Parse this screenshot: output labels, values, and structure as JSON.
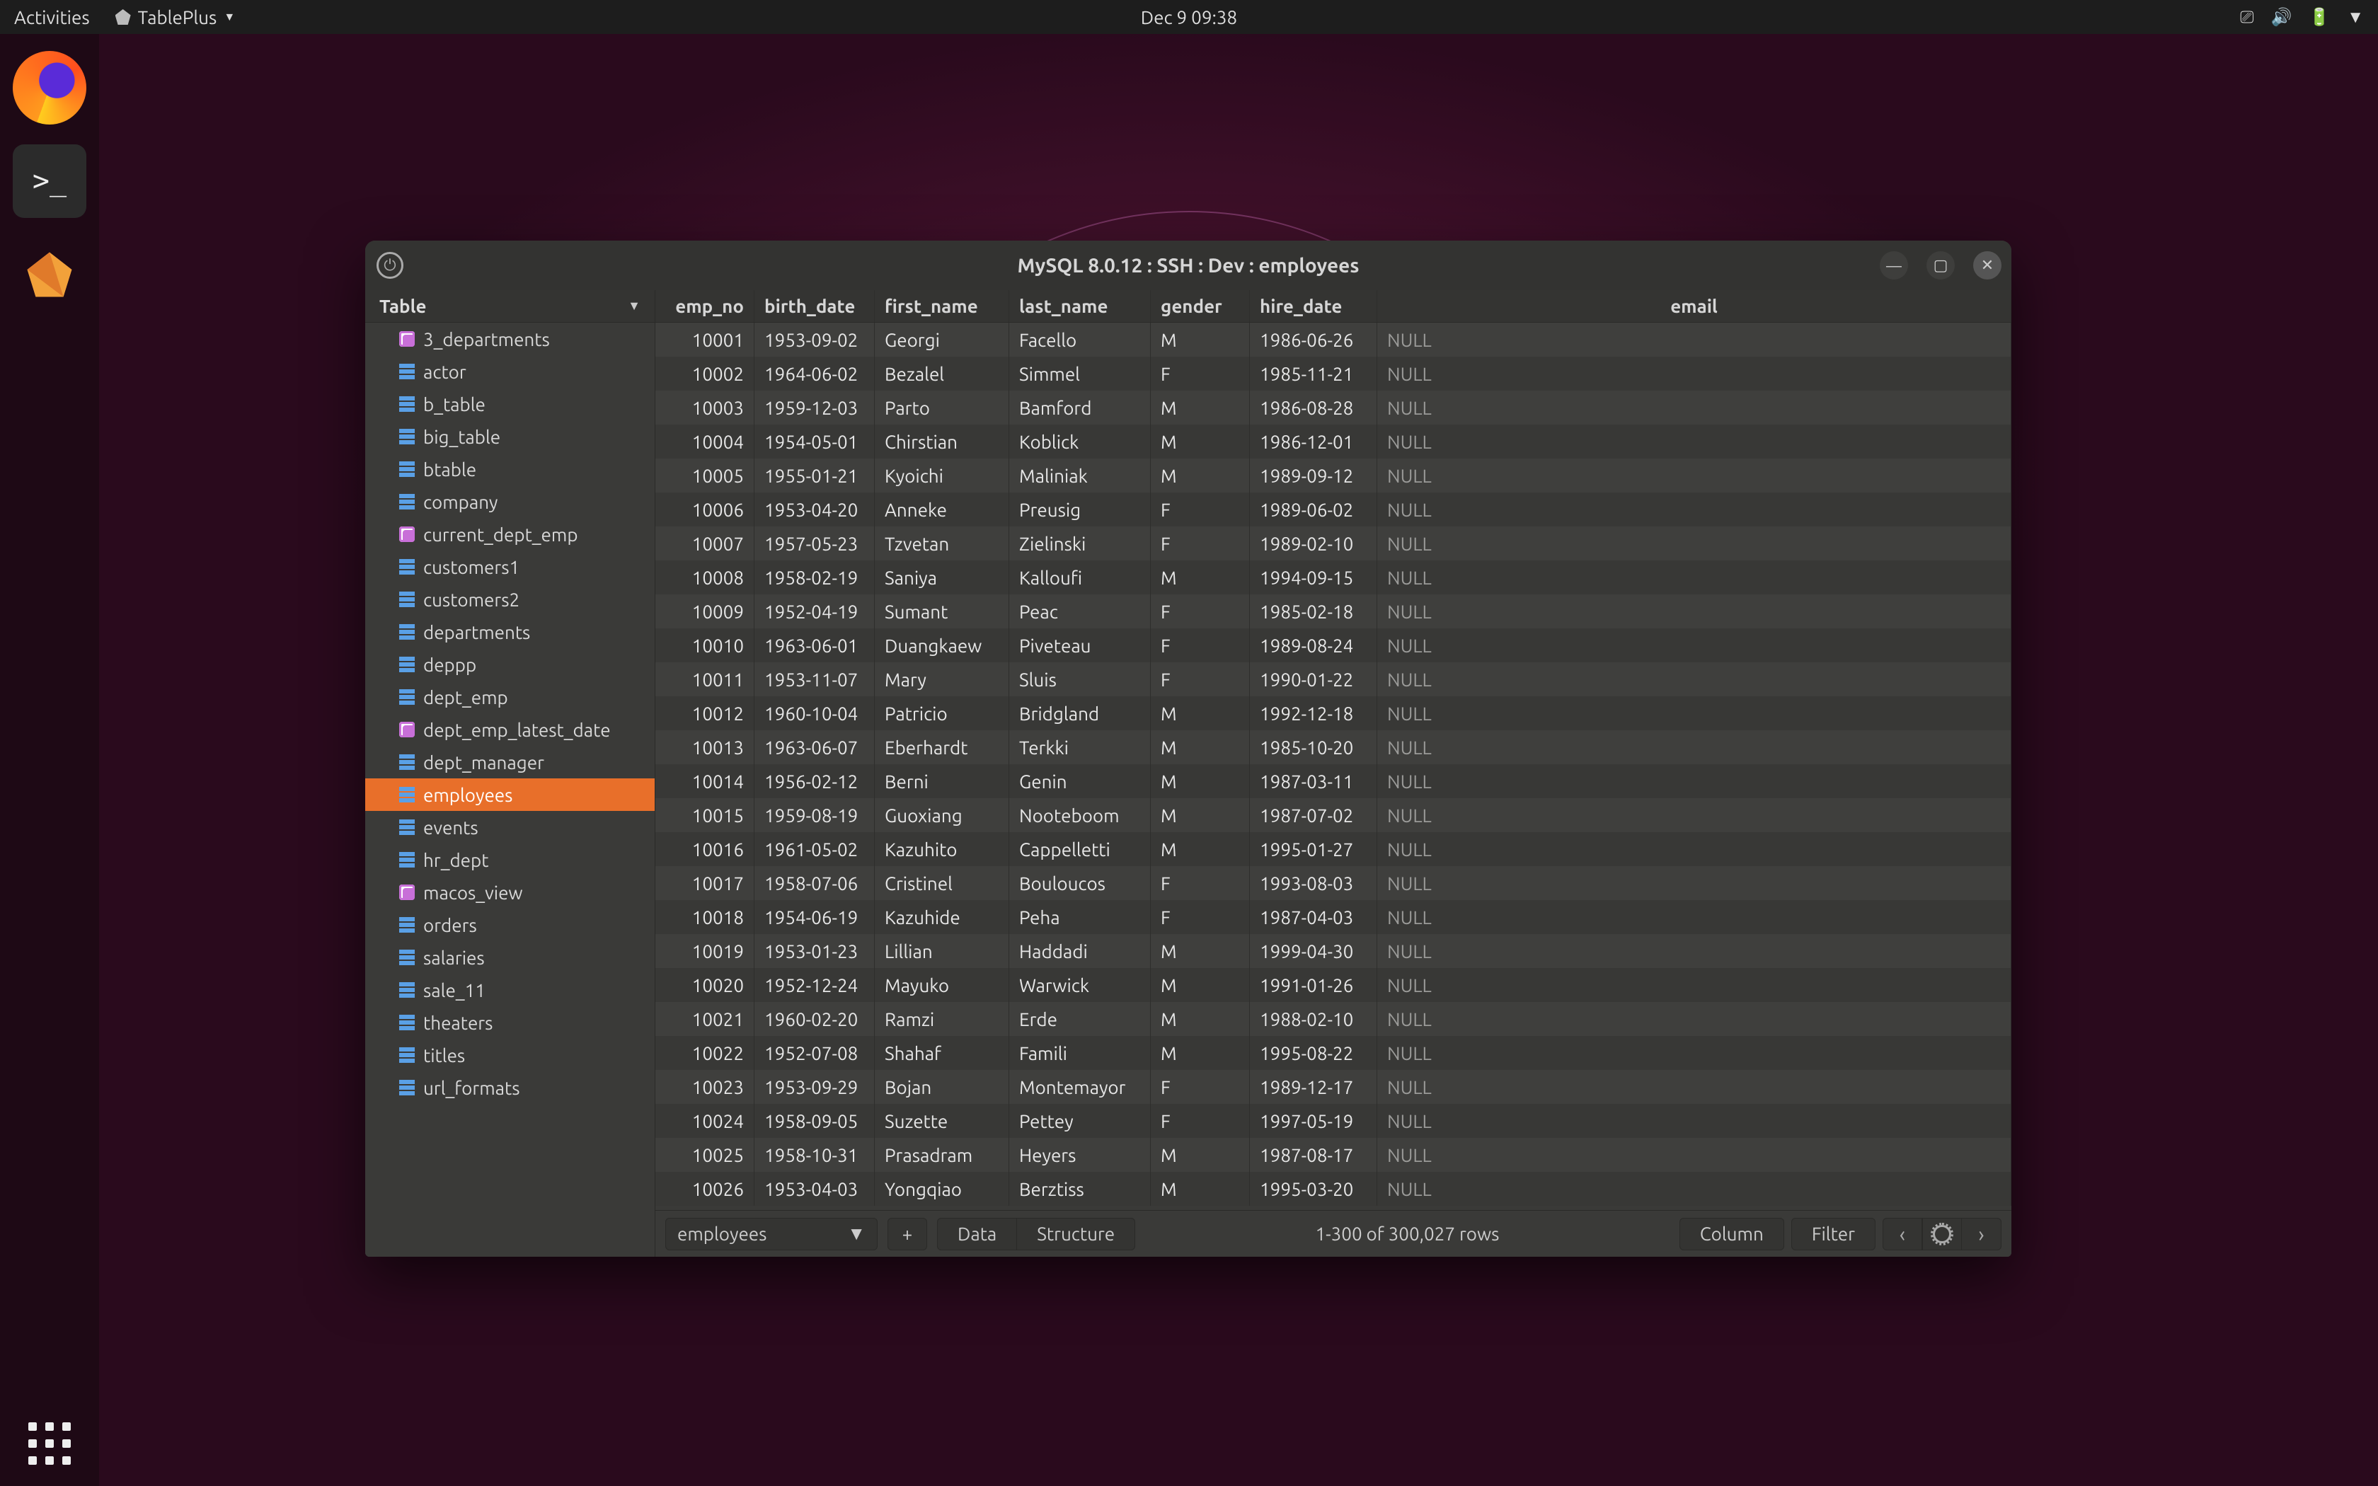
{
  "topbar": {
    "activities": "Activities",
    "app_name": "TablePlus",
    "clock": "Dec 9  09:38"
  },
  "window": {
    "title": "MySQL 8.0.12  :  SSH  :  Dev  :  employees"
  },
  "sidebar": {
    "header": "Table",
    "selected": "employees",
    "items": [
      {
        "name": "3_departments",
        "kind": "view"
      },
      {
        "name": "actor",
        "kind": "table"
      },
      {
        "name": "b_table",
        "kind": "table"
      },
      {
        "name": "big_table",
        "kind": "table"
      },
      {
        "name": "btable",
        "kind": "table"
      },
      {
        "name": "company",
        "kind": "table"
      },
      {
        "name": "current_dept_emp",
        "kind": "view"
      },
      {
        "name": "customers1",
        "kind": "table"
      },
      {
        "name": "customers2",
        "kind": "table"
      },
      {
        "name": "departments",
        "kind": "table"
      },
      {
        "name": "deppp",
        "kind": "table"
      },
      {
        "name": "dept_emp",
        "kind": "table"
      },
      {
        "name": "dept_emp_latest_date",
        "kind": "view"
      },
      {
        "name": "dept_manager",
        "kind": "table"
      },
      {
        "name": "employees",
        "kind": "table"
      },
      {
        "name": "events",
        "kind": "table"
      },
      {
        "name": "hr_dept",
        "kind": "table"
      },
      {
        "name": "macos_view",
        "kind": "view"
      },
      {
        "name": "orders",
        "kind": "table"
      },
      {
        "name": "salaries",
        "kind": "table"
      },
      {
        "name": "sale_11",
        "kind": "table"
      },
      {
        "name": "theaters",
        "kind": "table"
      },
      {
        "name": "titles",
        "kind": "table"
      },
      {
        "name": "url_formats",
        "kind": "table"
      }
    ]
  },
  "grid": {
    "columns": [
      "emp_no",
      "birth_date",
      "first_name",
      "last_name",
      "gender",
      "hire_date",
      "email"
    ],
    "null_label": "NULL",
    "rows": [
      [
        "10001",
        "1953-09-02",
        "Georgi",
        "Facello",
        "M",
        "1986-06-26",
        null
      ],
      [
        "10002",
        "1964-06-02",
        "Bezalel",
        "Simmel",
        "F",
        "1985-11-21",
        null
      ],
      [
        "10003",
        "1959-12-03",
        "Parto",
        "Bamford",
        "M",
        "1986-08-28",
        null
      ],
      [
        "10004",
        "1954-05-01",
        "Chirstian",
        "Koblick",
        "M",
        "1986-12-01",
        null
      ],
      [
        "10005",
        "1955-01-21",
        "Kyoichi",
        "Maliniak",
        "M",
        "1989-09-12",
        null
      ],
      [
        "10006",
        "1953-04-20",
        "Anneke",
        "Preusig",
        "F",
        "1989-06-02",
        null
      ],
      [
        "10007",
        "1957-05-23",
        "Tzvetan",
        "Zielinski",
        "F",
        "1989-02-10",
        null
      ],
      [
        "10008",
        "1958-02-19",
        "Saniya",
        "Kalloufi",
        "M",
        "1994-09-15",
        null
      ],
      [
        "10009",
        "1952-04-19",
        "Sumant",
        "Peac",
        "F",
        "1985-02-18",
        null
      ],
      [
        "10010",
        "1963-06-01",
        "Duangkaew",
        "Piveteau",
        "F",
        "1989-08-24",
        null
      ],
      [
        "10011",
        "1953-11-07",
        "Mary",
        "Sluis",
        "F",
        "1990-01-22",
        null
      ],
      [
        "10012",
        "1960-10-04",
        "Patricio",
        "Bridgland",
        "M",
        "1992-12-18",
        null
      ],
      [
        "10013",
        "1963-06-07",
        "Eberhardt",
        "Terkki",
        "M",
        "1985-10-20",
        null
      ],
      [
        "10014",
        "1956-02-12",
        "Berni",
        "Genin",
        "M",
        "1987-03-11",
        null
      ],
      [
        "10015",
        "1959-08-19",
        "Guoxiang",
        "Nooteboom",
        "M",
        "1987-07-02",
        null
      ],
      [
        "10016",
        "1961-05-02",
        "Kazuhito",
        "Cappelletti",
        "M",
        "1995-01-27",
        null
      ],
      [
        "10017",
        "1958-07-06",
        "Cristinel",
        "Bouloucos",
        "F",
        "1993-08-03",
        null
      ],
      [
        "10018",
        "1954-06-19",
        "Kazuhide",
        "Peha",
        "F",
        "1987-04-03",
        null
      ],
      [
        "10019",
        "1953-01-23",
        "Lillian",
        "Haddadi",
        "M",
        "1999-04-30",
        null
      ],
      [
        "10020",
        "1952-12-24",
        "Mayuko",
        "Warwick",
        "M",
        "1991-01-26",
        null
      ],
      [
        "10021",
        "1960-02-20",
        "Ramzi",
        "Erde",
        "M",
        "1988-02-10",
        null
      ],
      [
        "10022",
        "1952-07-08",
        "Shahaf",
        "Famili",
        "M",
        "1995-08-22",
        null
      ],
      [
        "10023",
        "1953-09-29",
        "Bojan",
        "Montemayor",
        "F",
        "1989-12-17",
        null
      ],
      [
        "10024",
        "1958-09-05",
        "Suzette",
        "Pettey",
        "F",
        "1997-05-19",
        null
      ],
      [
        "10025",
        "1958-10-31",
        "Prasadram",
        "Heyers",
        "M",
        "1987-08-17",
        null
      ],
      [
        "10026",
        "1953-04-03",
        "Yongqiao",
        "Berztiss",
        "M",
        "1995-03-20",
        null
      ]
    ]
  },
  "footer": {
    "table_select": "employees",
    "data_tab": "Data",
    "structure_tab": "Structure",
    "status": "1-300 of 300,027 rows",
    "column_btn": "Column",
    "filter_btn": "Filter"
  }
}
